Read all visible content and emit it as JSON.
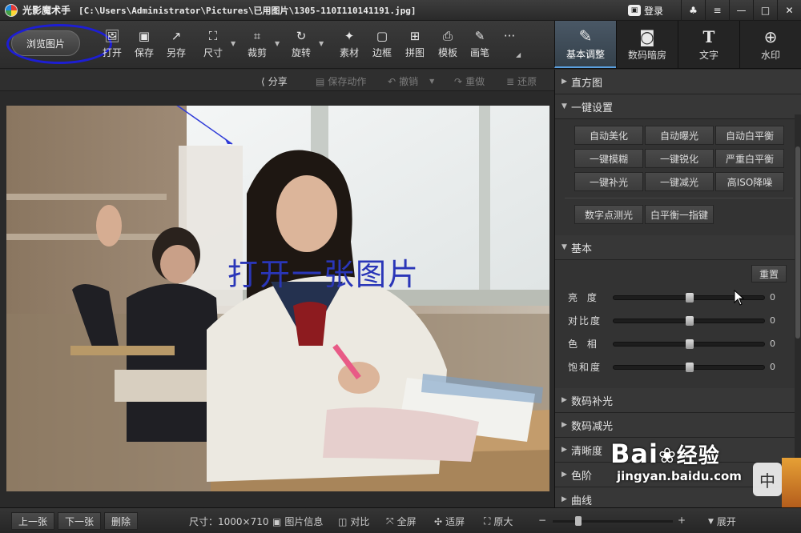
{
  "titlebar": {
    "app_name": "光影魔术手",
    "file_path": "[C:\\Users\\Administrator\\Pictures\\已用图片\\1305-110I110141191.jpg]",
    "login_label": "登录"
  },
  "toolbar": {
    "browse_label": "浏览图片",
    "open_label": "打开",
    "save_label": "保存",
    "saveas_label": "另存",
    "size_label": "尺寸",
    "crop_label": "裁剪",
    "rotate_label": "旋转",
    "material_label": "素材",
    "border_label": "边框",
    "collage_label": "拼图",
    "template_label": "模板",
    "brush_label": "画笔",
    "more_label": "···"
  },
  "tabs": [
    {
      "label": "基本调整",
      "icon": "edit-icon",
      "active": true
    },
    {
      "label": "数码暗房",
      "icon": "camera-icon",
      "active": false
    },
    {
      "label": "文字",
      "icon": "text-icon",
      "active": false
    },
    {
      "label": "水印",
      "icon": "watermark-icon",
      "active": false
    }
  ],
  "subbar": {
    "share": "分享",
    "save_action": "保存动作",
    "undo": "撤销",
    "redo": "重做",
    "restore": "还原"
  },
  "annotation": {
    "text": "打开一张图片",
    "color": "#1d1ed4"
  },
  "panel": {
    "histogram": "直方图",
    "one_click": "一键设置",
    "presets": [
      "自动美化",
      "自动曝光",
      "自动白平衡",
      "一键模糊",
      "一键锐化",
      "严重白平衡",
      "一键补光",
      "一键减光",
      "高ISO降噪"
    ],
    "presets_extra": [
      "数字点测光",
      "白平衡一指键"
    ],
    "basic": "基本",
    "reset": "重置",
    "sliders": [
      {
        "label": "亮 度",
        "value": "0",
        "pos": 0.5
      },
      {
        "label": "对比度",
        "value": "0",
        "pos": 0.5
      },
      {
        "label": "色 相",
        "value": "0",
        "pos": 0.5
      },
      {
        "label": "饱和度",
        "value": "0",
        "pos": 0.5
      }
    ],
    "sections": [
      "数码补光",
      "数码减光",
      "清晰度",
      "色阶",
      "曲线"
    ]
  },
  "statusbar": {
    "prev": "上一张",
    "next": "下一张",
    "delete": "删除",
    "size": "尺寸：1000×710",
    "info": "图片信息",
    "compare": "对比",
    "fullscreen": "全屏",
    "fit": "适屏",
    "original": "原大",
    "minus": "−",
    "plus": "+",
    "expand": "展开",
    "zoom_fraction": 0.2
  },
  "watermark": {
    "brand": "Bai",
    "brand2": "经验",
    "url": "jingyan.baidu.com",
    "ime": "中"
  }
}
